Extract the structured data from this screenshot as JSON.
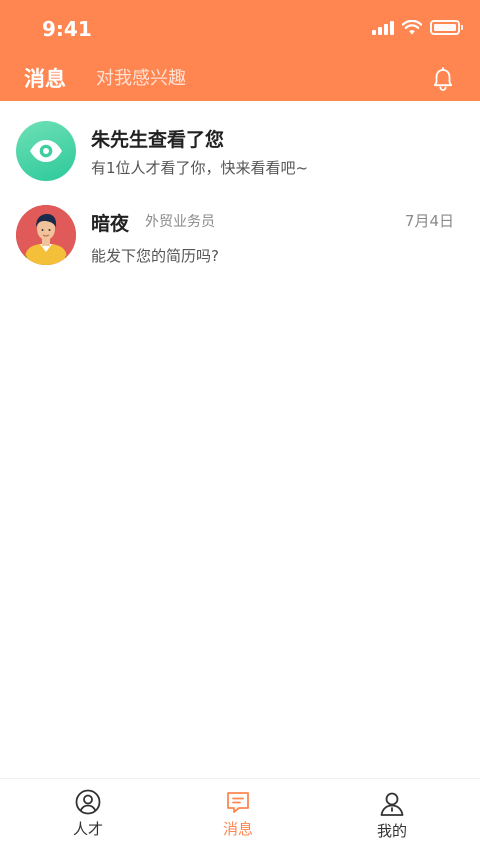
{
  "status_bar": {
    "time": "9:41"
  },
  "header": {
    "tabs": [
      {
        "label": "消息",
        "active": true
      },
      {
        "label": "对我感兴趣",
        "active": false
      }
    ],
    "accent_color": "#ff8651"
  },
  "messages": [
    {
      "title": "朱先生查看了您",
      "subtitle": "有1位人才看了你，快来看看吧~",
      "icon": "eye-icon"
    },
    {
      "name": "暗夜",
      "role": "外贸业务员",
      "date": "7月4日",
      "preview": "能发下您的简历吗?"
    }
  ],
  "bottom_nav": [
    {
      "label": "人才",
      "icon": "talent-icon",
      "active": false
    },
    {
      "label": "消息",
      "icon": "message-icon",
      "active": true
    },
    {
      "label": "我的",
      "icon": "profile-icon",
      "active": false
    }
  ]
}
